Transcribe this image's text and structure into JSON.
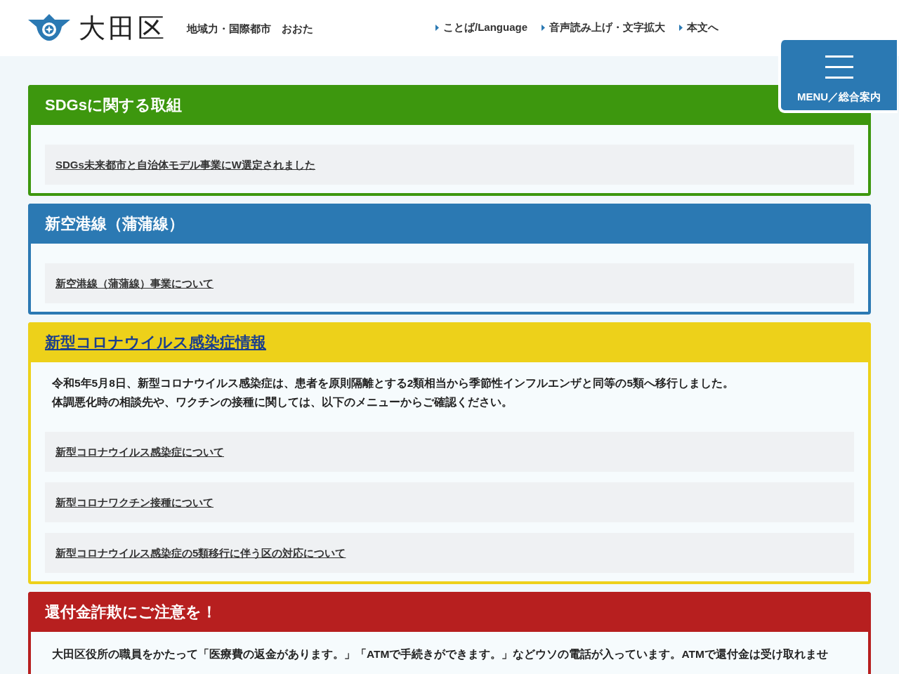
{
  "header": {
    "site_name": "大田区",
    "tagline": "地域力・国際都市　おおた",
    "links": [
      {
        "label": "ことば/Language"
      },
      {
        "label": "音声読み上げ・文字拡大"
      },
      {
        "label": "本文へ"
      }
    ],
    "menu_button": {
      "label": "MENU／総合案内"
    }
  },
  "sections": [
    {
      "title": "SDGsに関する取組",
      "color": "#3d970e",
      "title_link": false,
      "links": [
        "SDGs未来都市と自治体モデル事業にW選定されました"
      ]
    },
    {
      "title": "新空港線（蒲蒲線）",
      "color": "#2b79b3",
      "title_link": false,
      "links": [
        "新空港線（蒲蒲線）事業について"
      ]
    },
    {
      "title": "新型コロナウイルス感染症情報",
      "color": "#edd11a",
      "title_link": true,
      "paragraphs": [
        "令和5年5月8日、新型コロナウイルス感染症は、患者を原則隔離とする2類相当から季節性インフルエンザと同等の5類へ移行しました。",
        "体調悪化時の相談先や、ワクチンの接種に関しては、以下のメニューからご確認ください。"
      ],
      "links": [
        "新型コロナウイルス感染症について",
        "新型コロナワクチン接種について",
        "新型コロナウイルス感染症の5類移行に伴う区の対応について"
      ]
    },
    {
      "title": "還付金詐欺にご注意を！",
      "color": "#b71f1f",
      "title_link": false,
      "paragraphs": [
        "大田区役所の職員をかたって「医療費の返金があります。」「ATMで手続きができます。」などウソの電話が入っています。ATMで還付金は受け取れませ"
      ]
    }
  ]
}
